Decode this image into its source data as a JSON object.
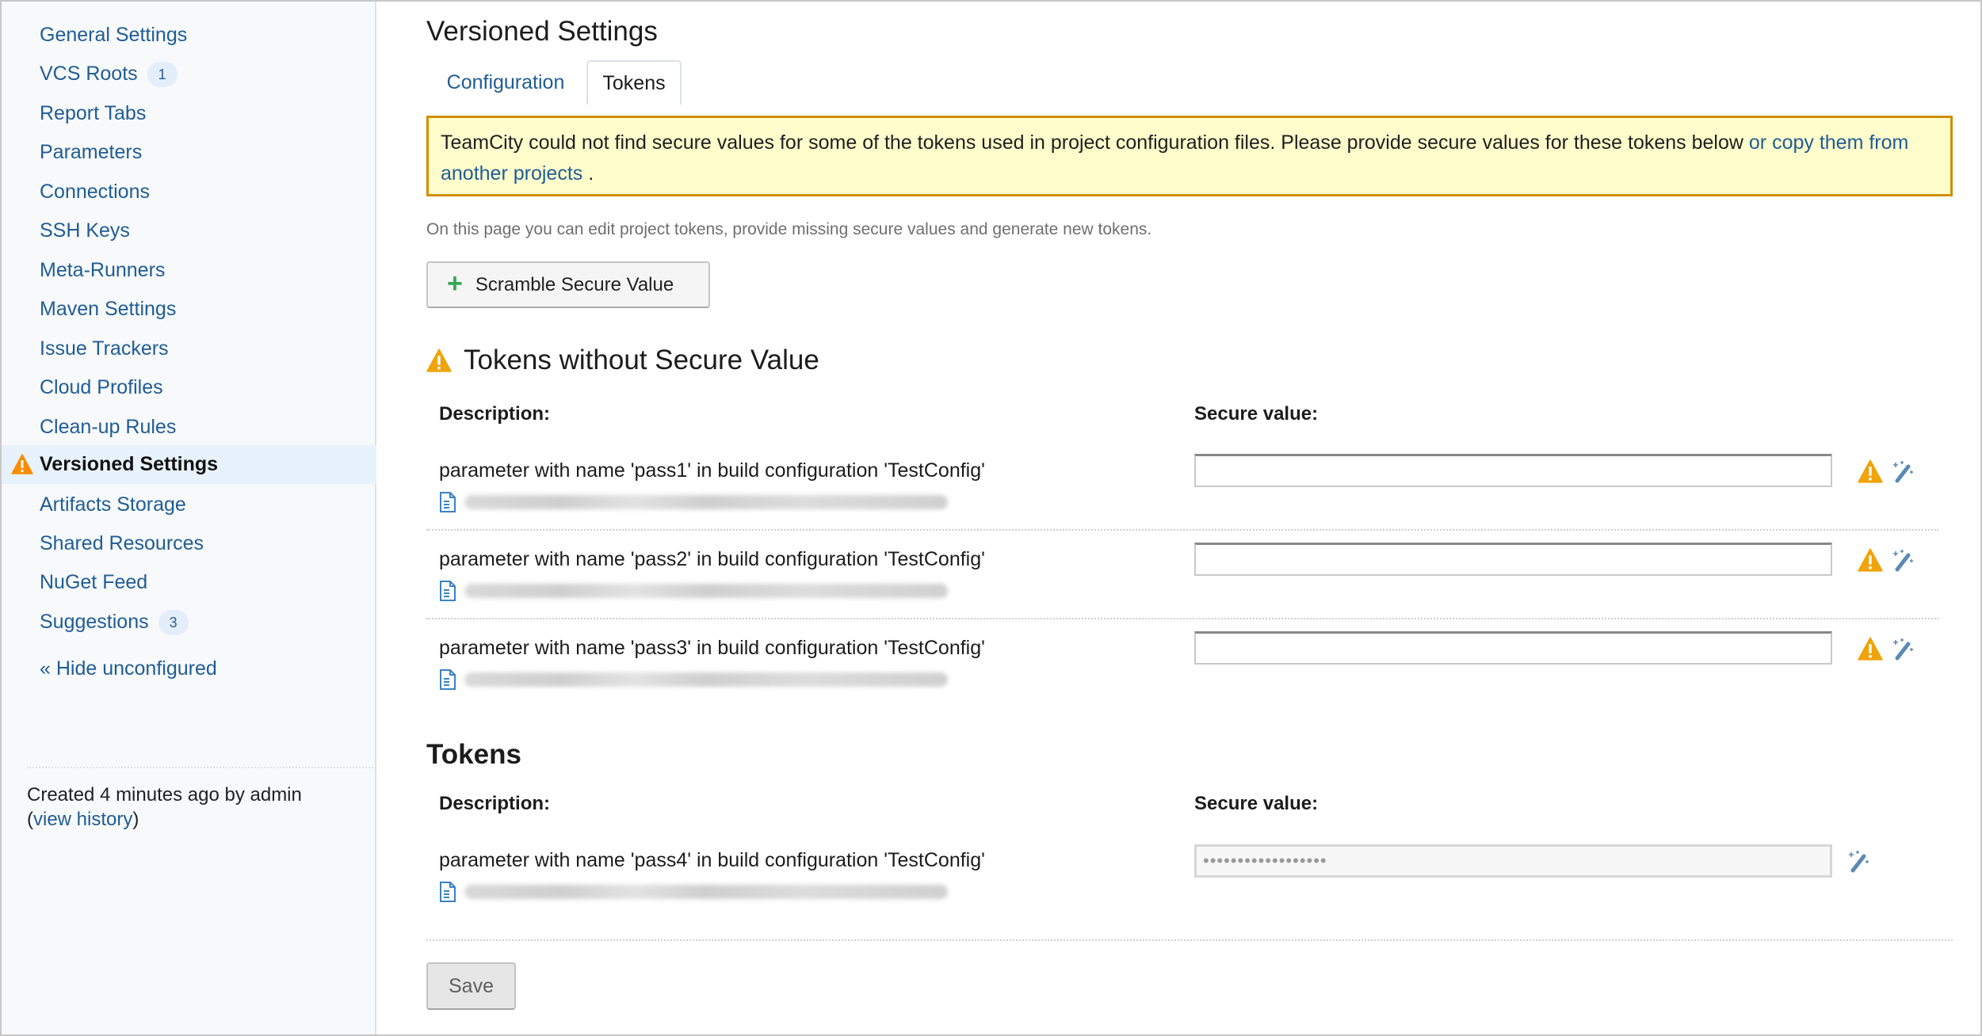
{
  "sidebar": {
    "items": [
      {
        "label": "General Settings"
      },
      {
        "label": "VCS Roots",
        "badge": "1"
      },
      {
        "label": "Report Tabs"
      },
      {
        "label": "Parameters"
      },
      {
        "label": "Connections"
      },
      {
        "label": "SSH Keys"
      },
      {
        "label": "Meta-Runners"
      },
      {
        "label": "Maven Settings"
      },
      {
        "label": "Issue Trackers"
      },
      {
        "label": "Cloud Profiles"
      },
      {
        "label": "Clean-up Rules"
      },
      {
        "label": "Versioned Settings",
        "active": true,
        "icon": "warning-icon"
      },
      {
        "label": "Artifacts Storage"
      },
      {
        "label": "Shared Resources"
      },
      {
        "label": "NuGet Feed"
      },
      {
        "label": "Suggestions",
        "badge": "3"
      }
    ],
    "hide_unconfigured": "« Hide unconfigured",
    "created_text": "Created 4 minutes ago by admin",
    "view_history_open": "(",
    "view_history": "view history",
    "view_history_close": ")"
  },
  "page": {
    "title": "Versioned Settings",
    "tabs": [
      {
        "label": "Configuration",
        "active": false
      },
      {
        "label": "Tokens",
        "active": true
      }
    ],
    "alert": {
      "text": "TeamCity could not find secure values for some of the tokens used in project configuration files. Please provide secure values for these tokens below ",
      "link": "or copy them from another projects",
      "suffix": " ."
    },
    "intro": "On this page you can edit project tokens, provide missing secure values and generate new tokens.",
    "scramble_button": "Scramble Secure Value",
    "missing_section": {
      "title": "Tokens without Secure Value",
      "col_description": "Description:",
      "col_secure": "Secure value:",
      "rows": [
        {
          "description": "parameter with name 'pass1' in build configuration 'TestConfig'",
          "value": ""
        },
        {
          "description": "parameter with name 'pass2' in build configuration 'TestConfig'",
          "value": ""
        },
        {
          "description": "parameter with name 'pass3' in build configuration 'TestConfig'",
          "value": ""
        }
      ]
    },
    "tokens_section": {
      "title": "Tokens",
      "col_description": "Description:",
      "col_secure": "Secure value:",
      "rows": [
        {
          "description": "parameter with name 'pass4' in build configuration 'TestConfig'",
          "value": "••••••••••••••••••"
        }
      ]
    },
    "save_button": "Save"
  },
  "colors": {
    "link": "#205d94",
    "warning": "#f0a30a",
    "alert_bg": "#fffdcc",
    "alert_border": "#d18f00",
    "plus": "#35a853"
  }
}
